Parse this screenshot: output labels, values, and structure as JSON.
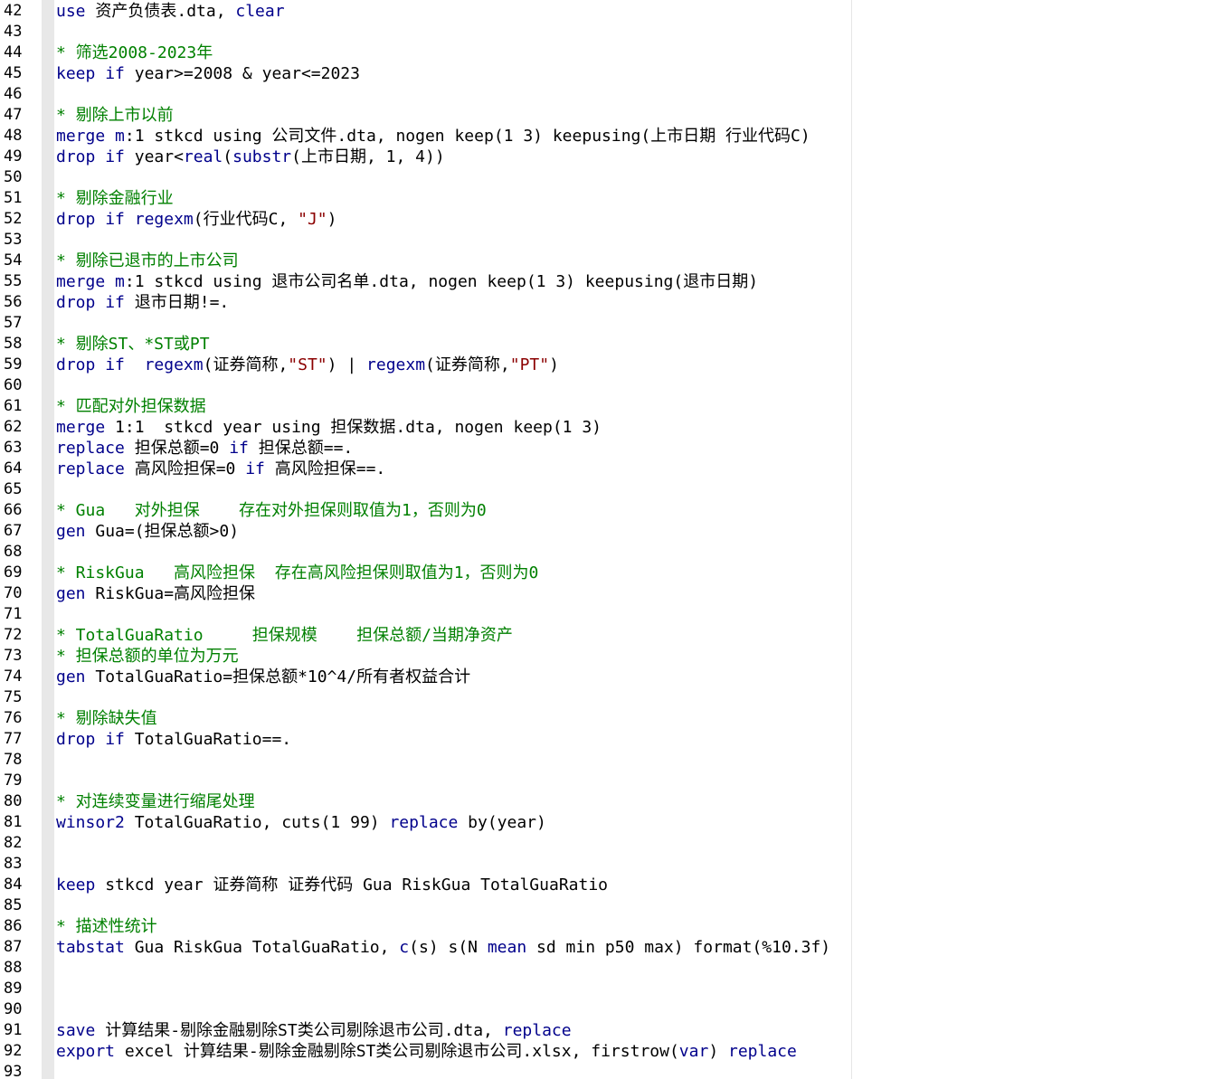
{
  "editor": {
    "lines": [
      {
        "n": "42",
        "tokens": [
          {
            "t": "use",
            "c": "kw"
          },
          {
            "t": " 资产负债表.dta, ",
            "c": "plain"
          },
          {
            "t": "clear",
            "c": "kw"
          }
        ]
      },
      {
        "n": "43",
        "tokens": []
      },
      {
        "n": "44",
        "tokens": [
          {
            "t": "* 筛选2008-2023年",
            "c": "cmt"
          }
        ]
      },
      {
        "n": "45",
        "tokens": [
          {
            "t": "keep",
            "c": "kw"
          },
          {
            "t": " ",
            "c": "plain"
          },
          {
            "t": "if",
            "c": "kw"
          },
          {
            "t": " year>=2008 & year<=2023",
            "c": "plain"
          }
        ]
      },
      {
        "n": "46",
        "tokens": []
      },
      {
        "n": "47",
        "tokens": [
          {
            "t": "* 剔除上市以前",
            "c": "cmt"
          }
        ]
      },
      {
        "n": "48",
        "tokens": [
          {
            "t": "merge",
            "c": "kw"
          },
          {
            "t": " ",
            "c": "plain"
          },
          {
            "t": "m",
            "c": "kw"
          },
          {
            "t": ":1 stkcd using 公司文件.dta, nogen keep(1 3) keepusing(上市日期 行业代码C)",
            "c": "plain"
          }
        ]
      },
      {
        "n": "49",
        "tokens": [
          {
            "t": "drop",
            "c": "kw"
          },
          {
            "t": " ",
            "c": "plain"
          },
          {
            "t": "if",
            "c": "kw"
          },
          {
            "t": " year<",
            "c": "plain"
          },
          {
            "t": "real",
            "c": "kw"
          },
          {
            "t": "(",
            "c": "plain"
          },
          {
            "t": "substr",
            "c": "kw"
          },
          {
            "t": "(上市日期, 1, 4))",
            "c": "plain"
          }
        ]
      },
      {
        "n": "50",
        "tokens": []
      },
      {
        "n": "51",
        "tokens": [
          {
            "t": "* 剔除金融行业",
            "c": "cmt"
          }
        ]
      },
      {
        "n": "52",
        "tokens": [
          {
            "t": "drop",
            "c": "kw"
          },
          {
            "t": " ",
            "c": "plain"
          },
          {
            "t": "if",
            "c": "kw"
          },
          {
            "t": " ",
            "c": "plain"
          },
          {
            "t": "regexm",
            "c": "kw"
          },
          {
            "t": "(行业代码C, ",
            "c": "plain"
          },
          {
            "t": "\"J\"",
            "c": "str"
          },
          {
            "t": ")",
            "c": "plain"
          }
        ]
      },
      {
        "n": "53",
        "tokens": []
      },
      {
        "n": "54",
        "tokens": [
          {
            "t": "* 剔除已退市的上市公司",
            "c": "cmt"
          }
        ]
      },
      {
        "n": "55",
        "tokens": [
          {
            "t": "merge",
            "c": "kw"
          },
          {
            "t": " ",
            "c": "plain"
          },
          {
            "t": "m",
            "c": "kw"
          },
          {
            "t": ":1 stkcd using 退市公司名单.dta, nogen keep(1 3) keepusing(退市日期)",
            "c": "plain"
          }
        ]
      },
      {
        "n": "56",
        "tokens": [
          {
            "t": "drop",
            "c": "kw"
          },
          {
            "t": " ",
            "c": "plain"
          },
          {
            "t": "if",
            "c": "kw"
          },
          {
            "t": " 退市日期!=.",
            "c": "plain"
          }
        ]
      },
      {
        "n": "57",
        "tokens": []
      },
      {
        "n": "58",
        "tokens": [
          {
            "t": "* 剔除ST、*ST或PT",
            "c": "cmt"
          }
        ]
      },
      {
        "n": "59",
        "tokens": [
          {
            "t": "drop",
            "c": "kw"
          },
          {
            "t": " ",
            "c": "plain"
          },
          {
            "t": "if",
            "c": "kw"
          },
          {
            "t": "  ",
            "c": "plain"
          },
          {
            "t": "regexm",
            "c": "kw"
          },
          {
            "t": "(证券简称,",
            "c": "plain"
          },
          {
            "t": "\"ST\"",
            "c": "str"
          },
          {
            "t": ") | ",
            "c": "plain"
          },
          {
            "t": "regexm",
            "c": "kw"
          },
          {
            "t": "(证券简称,",
            "c": "plain"
          },
          {
            "t": "\"PT\"",
            "c": "str"
          },
          {
            "t": ")",
            "c": "plain"
          }
        ]
      },
      {
        "n": "60",
        "tokens": []
      },
      {
        "n": "61",
        "tokens": [
          {
            "t": "* 匹配对外担保数据",
            "c": "cmt"
          }
        ]
      },
      {
        "n": "62",
        "tokens": [
          {
            "t": "merge",
            "c": "kw"
          },
          {
            "t": " 1:1  stkcd year using 担保数据.dta, nogen keep(1 3)",
            "c": "plain"
          }
        ]
      },
      {
        "n": "63",
        "tokens": [
          {
            "t": "replace",
            "c": "kw"
          },
          {
            "t": " 担保总额=0 ",
            "c": "plain"
          },
          {
            "t": "if",
            "c": "kw"
          },
          {
            "t": " 担保总额==.",
            "c": "plain"
          }
        ]
      },
      {
        "n": "64",
        "tokens": [
          {
            "t": "replace",
            "c": "kw"
          },
          {
            "t": " 高风险担保=0 ",
            "c": "plain"
          },
          {
            "t": "if",
            "c": "kw"
          },
          {
            "t": " 高风险担保==.",
            "c": "plain"
          }
        ]
      },
      {
        "n": "65",
        "tokens": []
      },
      {
        "n": "66",
        "tokens": [
          {
            "t": "* Gua   对外担保    存在对外担保则取值为1，否则为0",
            "c": "cmt"
          }
        ]
      },
      {
        "n": "67",
        "tokens": [
          {
            "t": "gen",
            "c": "kw"
          },
          {
            "t": " Gua=(担保总额>0)",
            "c": "plain"
          }
        ]
      },
      {
        "n": "68",
        "tokens": []
      },
      {
        "n": "69",
        "tokens": [
          {
            "t": "* RiskGua   高风险担保  存在高风险担保则取值为1，否则为0",
            "c": "cmt"
          }
        ]
      },
      {
        "n": "70",
        "tokens": [
          {
            "t": "gen",
            "c": "kw"
          },
          {
            "t": " RiskGua=高风险担保",
            "c": "plain"
          }
        ]
      },
      {
        "n": "71",
        "tokens": []
      },
      {
        "n": "72",
        "tokens": [
          {
            "t": "* TotalGuaRatio     担保规模    担保总额/当期净资产",
            "c": "cmt"
          }
        ]
      },
      {
        "n": "73",
        "tokens": [
          {
            "t": "* 担保总额的单位为万元",
            "c": "cmt"
          }
        ]
      },
      {
        "n": "74",
        "tokens": [
          {
            "t": "gen",
            "c": "kw"
          },
          {
            "t": " TotalGuaRatio=担保总额*10^4/所有者权益合计",
            "c": "plain"
          }
        ]
      },
      {
        "n": "75",
        "tokens": []
      },
      {
        "n": "76",
        "tokens": [
          {
            "t": "* 剔除缺失值",
            "c": "cmt"
          }
        ]
      },
      {
        "n": "77",
        "tokens": [
          {
            "t": "drop",
            "c": "kw"
          },
          {
            "t": " ",
            "c": "plain"
          },
          {
            "t": "if",
            "c": "kw"
          },
          {
            "t": " TotalGuaRatio==.",
            "c": "plain"
          }
        ]
      },
      {
        "n": "78",
        "tokens": []
      },
      {
        "n": "79",
        "tokens": []
      },
      {
        "n": "80",
        "tokens": [
          {
            "t": "* 对连续变量进行缩尾处理",
            "c": "cmt"
          }
        ]
      },
      {
        "n": "81",
        "tokens": [
          {
            "t": "winsor2",
            "c": "kw"
          },
          {
            "t": " TotalGuaRatio, cuts(1 99) ",
            "c": "plain"
          },
          {
            "t": "replace",
            "c": "kw"
          },
          {
            "t": " by(year)",
            "c": "plain"
          }
        ]
      },
      {
        "n": "82",
        "tokens": []
      },
      {
        "n": "83",
        "tokens": []
      },
      {
        "n": "84",
        "tokens": [
          {
            "t": "keep",
            "c": "kw"
          },
          {
            "t": " stkcd year 证券简称 证券代码 Gua RiskGua TotalGuaRatio",
            "c": "plain"
          }
        ]
      },
      {
        "n": "85",
        "tokens": []
      },
      {
        "n": "86",
        "tokens": [
          {
            "t": "* 描述性统计",
            "c": "cmt"
          }
        ]
      },
      {
        "n": "87",
        "tokens": [
          {
            "t": "tabstat",
            "c": "kw"
          },
          {
            "t": " Gua RiskGua TotalGuaRatio, ",
            "c": "plain"
          },
          {
            "t": "c",
            "c": "kw"
          },
          {
            "t": "(s) s(N ",
            "c": "plain"
          },
          {
            "t": "mean",
            "c": "kw"
          },
          {
            "t": " sd min p50 max) format(%10.3f)",
            "c": "plain"
          }
        ]
      },
      {
        "n": "88",
        "tokens": []
      },
      {
        "n": "89",
        "tokens": []
      },
      {
        "n": "90",
        "tokens": []
      },
      {
        "n": "91",
        "tokens": [
          {
            "t": "save",
            "c": "kw"
          },
          {
            "t": " 计算结果-剔除金融剔除ST类公司剔除退市公司.dta, ",
            "c": "plain"
          },
          {
            "t": "replace",
            "c": "kw"
          }
        ]
      },
      {
        "n": "92",
        "tokens": [
          {
            "t": "export",
            "c": "kw"
          },
          {
            "t": " excel 计算结果-剔除金融剔除ST类公司剔除退市公司.xlsx, firstrow(",
            "c": "plain"
          },
          {
            "t": "var",
            "c": "kw"
          },
          {
            "t": ") ",
            "c": "plain"
          },
          {
            "t": "replace",
            "c": "kw"
          }
        ]
      },
      {
        "n": "93",
        "tokens": []
      }
    ]
  }
}
